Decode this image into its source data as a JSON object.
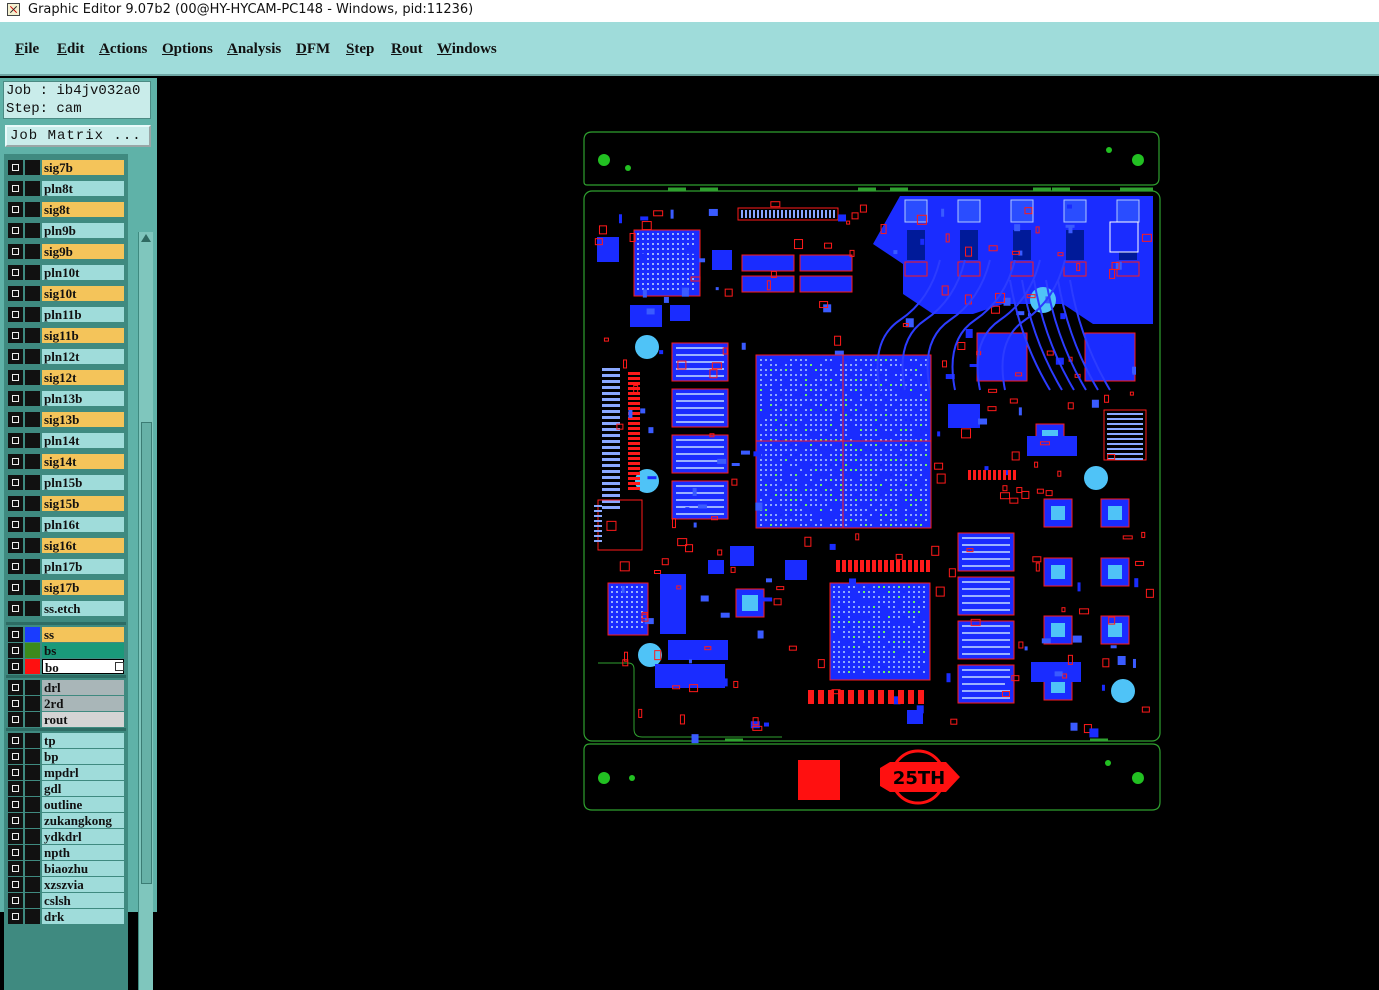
{
  "window": {
    "title": "Graphic Editor 9.07b2 (00@HY-HYCAM-PC148 - Windows, pid:11236)"
  },
  "menu": [
    {
      "label": "File",
      "name": "menu-file"
    },
    {
      "label": "Edit",
      "name": "menu-edit"
    },
    {
      "label": "Actions",
      "name": "menu-actions"
    },
    {
      "label": "Options",
      "name": "menu-options"
    },
    {
      "label": "Analysis",
      "name": "menu-analysis"
    },
    {
      "label": "DFM",
      "name": "menu-dfm"
    },
    {
      "label": "Step",
      "name": "menu-step"
    },
    {
      "label": "Rout",
      "name": "menu-rout"
    },
    {
      "label": "Windows",
      "name": "menu-windows"
    }
  ],
  "job": {
    "job_line": "Job : ib4jv032a0",
    "step_line": "Step: cam",
    "matrix_button": "Job Matrix ..."
  },
  "layers": [
    {
      "name": "sig7b",
      "color": "#f4c45a",
      "group": 1
    },
    {
      "name": "pln8t",
      "color": "#9fdcda",
      "group": 1
    },
    {
      "name": "sig8t",
      "color": "#f4c45a",
      "group": 1
    },
    {
      "name": "pln9b",
      "color": "#9fdcda",
      "group": 1
    },
    {
      "name": "sig9b",
      "color": "#f4c45a",
      "group": 1
    },
    {
      "name": "pln10t",
      "color": "#9fdcda",
      "group": 1
    },
    {
      "name": "sig10t",
      "color": "#f4c45a",
      "group": 1
    },
    {
      "name": "pln11b",
      "color": "#9fdcda",
      "group": 1
    },
    {
      "name": "sig11b",
      "color": "#f4c45a",
      "group": 1
    },
    {
      "name": "pln12t",
      "color": "#9fdcda",
      "group": 1
    },
    {
      "name": "sig12t",
      "color": "#f4c45a",
      "group": 1
    },
    {
      "name": "pln13b",
      "color": "#9fdcda",
      "group": 1
    },
    {
      "name": "sig13b",
      "color": "#f4c45a",
      "group": 1
    },
    {
      "name": "pln14t",
      "color": "#9fdcda",
      "group": 1
    },
    {
      "name": "sig14t",
      "color": "#f4c45a",
      "group": 1
    },
    {
      "name": "pln15b",
      "color": "#9fdcda",
      "group": 1
    },
    {
      "name": "sig15b",
      "color": "#f4c45a",
      "group": 1
    },
    {
      "name": "pln16t",
      "color": "#9fdcda",
      "group": 1
    },
    {
      "name": "sig16t",
      "color": "#f4c45a",
      "group": 1
    },
    {
      "name": "pln17b",
      "color": "#9fdcda",
      "group": 1
    },
    {
      "name": "sig17b",
      "color": "#f4c45a",
      "group": 1
    },
    {
      "name": "ss.etch",
      "color": "#9fdcda",
      "group": 1
    },
    {
      "name": "ss",
      "color": "#f4c45a",
      "swatch": "#1a3cff",
      "group": 2
    },
    {
      "name": "bs",
      "color": "#1a9a7a",
      "swatch": "#3c8a1c",
      "group": 2
    },
    {
      "name": "bo",
      "color": "#ffffff",
      "swatch": "#ff1010",
      "group": 2,
      "active": true
    },
    {
      "name": "drl",
      "color": "#a9b6b8",
      "group": 3
    },
    {
      "name": "2rd",
      "color": "#a9b6b8",
      "group": 3
    },
    {
      "name": "rout",
      "color": "#d4d4d4",
      "group": 3
    },
    {
      "name": "tp",
      "color": "#9fdcda",
      "group": 4
    },
    {
      "name": "bp",
      "color": "#9fdcda",
      "group": 4
    },
    {
      "name": "mpdrl",
      "color": "#9fdcda",
      "group": 4
    },
    {
      "name": "gdl",
      "color": "#9fdcda",
      "group": 4
    },
    {
      "name": "outline",
      "color": "#9fdcda",
      "group": 4
    },
    {
      "name": "zukangkong",
      "color": "#9fdcda",
      "group": 4
    },
    {
      "name": "ydkdrl",
      "color": "#9fdcda",
      "group": 4
    },
    {
      "name": "npth",
      "color": "#9fdcda",
      "group": 4
    },
    {
      "name": "biaozhu",
      "color": "#9fdcda",
      "group": 4
    },
    {
      "name": "xzszvia",
      "color": "#9fdcda",
      "group": 4
    },
    {
      "name": "cslsh",
      "color": "#9fdcda",
      "group": 4
    },
    {
      "name": "drk",
      "color": "#9fdcda",
      "group": 4
    }
  ],
  "board": {
    "logo_text": "25TH",
    "colors": {
      "outline": "#2fa02f",
      "top": "#1a2cff",
      "bottom": "#ff1a1a",
      "hole": "#4fc3f7",
      "fiducial": "#22c022"
    }
  }
}
